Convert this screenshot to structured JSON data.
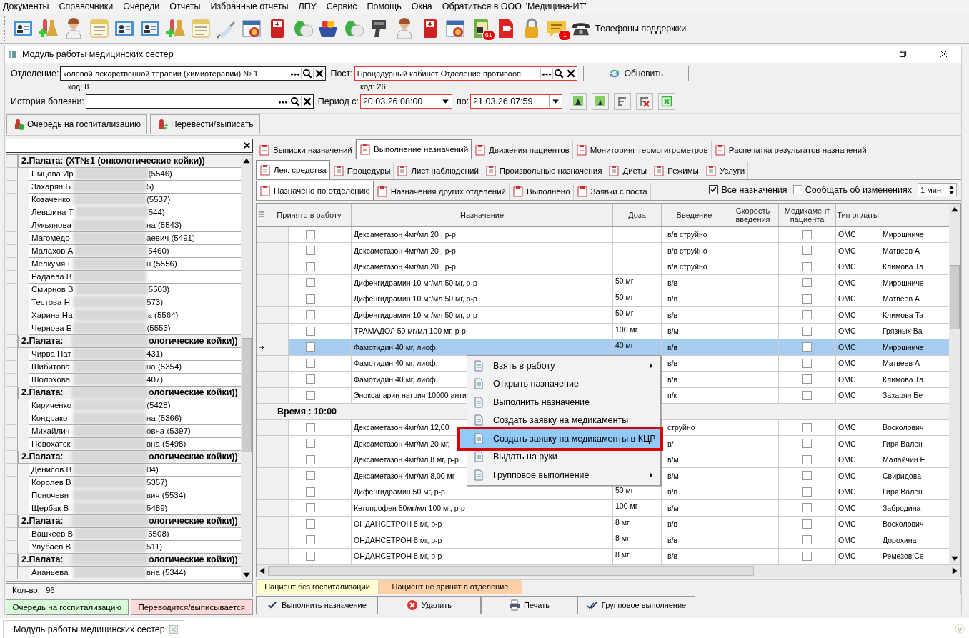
{
  "menu_bar": [
    "Документы",
    "Справочники",
    "Очереди",
    "Отчеты",
    "Избранные отчеты",
    "ЛПУ",
    "Сервис",
    "Помощь",
    "Окна",
    "Обратиться в ООО \"Медицина-ИТ\""
  ],
  "toolbar": {
    "badges": [
      "61",
      "1"
    ],
    "support": "Телефоны поддержки"
  },
  "window": {
    "title": "Модуль работы медицинских сестер"
  },
  "filters": {
    "department_label": "Отделение:",
    "department": "колевой лекарственной терапии (химиотерапии) № 1",
    "department_code": "код: 8",
    "post_label": "Пост:",
    "post": "Процедурный кабинет Отделение противооп",
    "post_code": "код: 26",
    "refresh": "Обновить",
    "history_label": "История болезни:",
    "period_from_label": "Период с:",
    "period_from": "20.03.26 08:00",
    "period_to_label": "по:",
    "period_to": "21.03.26 07:59"
  },
  "actions": [
    "Очередь на госпитализацию",
    "Перевести/выписать"
  ],
  "patients": {
    "groups": [
      {
        "prefix": "2.Палата:  (ХТ№1 (онкологические койки))",
        "children": [
          {
            "prefix": "Емцова Ир",
            "suffix": "(5546)"
          },
          {
            "prefix": "Захарян Б",
            "suffix": "5)"
          },
          {
            "prefix": "Козаченко",
            "suffix": "(5537)"
          },
          {
            "prefix": "Левшина Т",
            "suffix": "544)"
          },
          {
            "prefix": "Лукьянова",
            "suffix": "на (5543)"
          },
          {
            "prefix": "Магомедо",
            "suffix": "аевич (5491)"
          },
          {
            "prefix": "Малахов А",
            "suffix": "5460)"
          },
          {
            "prefix": "Мелкумян",
            "suffix": "н (5556)"
          },
          {
            "prefix": "Радаева В"
          },
          {
            "prefix": "Смирнов В",
            "suffix": "5503)"
          },
          {
            "prefix": "Тестова Н",
            "suffix": "573)"
          },
          {
            "prefix": "Харина На",
            "suffix": "а (5564)"
          },
          {
            "prefix": "Чернова Е",
            "suffix": "(5553)"
          }
        ]
      },
      {
        "prefix": "2.Палата:",
        "suffix": "ологические койки))",
        "children": [
          {
            "prefix": "Чирва Нат",
            "suffix": "431)"
          },
          {
            "prefix": "Шибитова",
            "suffix": "на (5354)"
          },
          {
            "prefix": "Шолохова",
            "suffix": "407)"
          }
        ]
      },
      {
        "prefix": "2.Палата:",
        "suffix": "ологические койки))",
        "children": [
          {
            "prefix": "Кириченко",
            "suffix": "(5428)"
          },
          {
            "prefix": "Кондрако",
            "suffix": "на (5366)"
          },
          {
            "prefix": "Михайлич",
            "suffix": "овна (5397)"
          },
          {
            "prefix": "Новохатск",
            "suffix": "вна (5498)"
          }
        ]
      },
      {
        "prefix": "2.Палата:",
        "suffix": "ологические койки))",
        "children": [
          {
            "prefix": "Денисов В",
            "suffix": "04)"
          },
          {
            "prefix": "Королев В",
            "suffix": "5357)"
          },
          {
            "prefix": "Поночевн",
            "suffix": "вич (5534)"
          },
          {
            "prefix": "Щербак В",
            "suffix": "5489)"
          }
        ]
      },
      {
        "prefix": "2.Палата:",
        "suffix": "ологические койки))",
        "children": [
          {
            "prefix": "Вашкеев В",
            "suffix": "5508)"
          },
          {
            "prefix": "Улубаев В",
            "suffix": "511)"
          }
        ]
      },
      {
        "prefix": "2.Палата:",
        "suffix": "ологические койки))",
        "children": [
          {
            "prefix": "Ананьева",
            "suffix": "вна (5344)"
          }
        ]
      }
    ],
    "count_label": "Кол-во:",
    "count": "96",
    "legend": [
      {
        "label": "Очередь на госпитализацию",
        "color": "#d8fbd8"
      },
      {
        "label": "Переводится/выписывается",
        "color": "#ffd8d8"
      }
    ]
  },
  "tabs": [
    {
      "label": "Выписки назначений",
      "selected": false
    },
    {
      "label": "Выполнение назначений",
      "selected": true
    },
    {
      "label": "Движения пациентов",
      "selected": false
    },
    {
      "label": "Мониторинг термогигрометров",
      "selected": false
    },
    {
      "label": "Распечатка результатов назначений",
      "selected": false
    }
  ],
  "subtabs": [
    {
      "label": "Лек. средства",
      "selected": true
    },
    {
      "label": "Процедуры",
      "selected": false
    },
    {
      "label": "Лист наблюдений",
      "selected": false
    },
    {
      "label": "Произвольные назначения",
      "selected": false
    },
    {
      "label": "Диеты",
      "selected": false
    },
    {
      "label": "Режимы",
      "selected": false
    },
    {
      "label": "Услуги",
      "selected": false
    }
  ],
  "view_tabs": [
    {
      "label": "Назначено по отделению",
      "selected": true
    },
    {
      "label": "Назначения других отделений",
      "selected": false
    },
    {
      "label": "Выполнено",
      "selected": false
    },
    {
      "label": "Заявки с поста",
      "selected": false
    }
  ],
  "options": {
    "all": {
      "label": "Все назначения",
      "checked": true
    },
    "notify": {
      "label": "Сообщать об изменениях",
      "checked": false
    },
    "interval": "1 мин"
  },
  "table": {
    "columns": [
      "Принято в работу",
      "Назначение",
      "Доза",
      "Введение",
      "Скорость введения",
      "Медикамент пациента",
      "Тип оплаты"
    ],
    "rows": [
      {
        "kind": "item",
        "accepted": false,
        "name": "Дексаметазон 4мг/мл 20 , р-р",
        "dose": "",
        "route": "в/в струйно",
        "own": false,
        "pay": "ОМС",
        "column_9": "Мирошниче",
        "selected": false
      },
      {
        "kind": "item",
        "accepted": false,
        "name": "Дексаметазон 4мг/мл 20 , р-р",
        "dose": "",
        "route": "в/в струйно",
        "own": false,
        "pay": "ОМС",
        "column_9": "Матвеев А",
        "selected": false
      },
      {
        "kind": "item",
        "accepted": false,
        "name": "Дексаметазон 4мг/мл 20 , р-р",
        "dose": "",
        "route": "в/в струйно",
        "own": false,
        "pay": "ОМС",
        "column_9": "Климова Та",
        "selected": false
      },
      {
        "kind": "item",
        "accepted": false,
        "name": "Дифенгидрамин 10 мг/мл 50 мг, р-р",
        "dose": "50 мг",
        "route": "в/в",
        "own": false,
        "pay": "ОМС",
        "column_9": "Мирошниче",
        "selected": false
      },
      {
        "kind": "item",
        "accepted": false,
        "name": "Дифенгидрамин 10 мг/мл 50 мг, р-р",
        "dose": "50 мг",
        "route": "в/в",
        "own": false,
        "pay": "ОМС",
        "column_9": "Матвеев А",
        "selected": false
      },
      {
        "kind": "item",
        "accepted": false,
        "name": "Дифенгидрамин 10 мг/мл 50 мг, р-р",
        "dose": "50 мг",
        "route": "в/в",
        "own": false,
        "pay": "ОМС",
        "column_9": "Климова Та",
        "selected": false
      },
      {
        "kind": "item",
        "accepted": false,
        "name": "ТРАМАДОЛ 50 мг/мл 100 мг, р-р",
        "dose": "100 мг",
        "route": "в/м",
        "own": false,
        "pay": "ОМС",
        "column_9": "Грязных Ва",
        "selected": false
      },
      {
        "kind": "item",
        "accepted": false,
        "name": "Фамотидин 40 мг, лиоф.",
        "dose": "40 мг",
        "route": "в/в",
        "own": false,
        "pay": "ОМС",
        "column_9": "Мирошниче",
        "selected": true
      },
      {
        "kind": "item",
        "accepted": false,
        "name": "Фамотидин 40 мг, лиоф.",
        "dose": "",
        "route": "в/в",
        "own": false,
        "pay": "ОМС",
        "column_9": "Матвеев А",
        "selected": false
      },
      {
        "kind": "item",
        "accepted": false,
        "name": "Фамотидин 40 мг, лиоф.",
        "dose": "",
        "route": "в/в",
        "own": false,
        "pay": "ОМС",
        "column_9": "Климова Та",
        "selected": false
      },
      {
        "kind": "item",
        "accepted": false,
        "name": "Эноксапарин натрия 10000 анти",
        "dose": "",
        "route": "п/к",
        "own": false,
        "pay": "ОМС",
        "column_9": "Захарян Бе",
        "selected": false
      },
      {
        "kind": "time",
        "label": "Время : 10:00"
      },
      {
        "kind": "item",
        "accepted": false,
        "name": "Дексаметазон 4мг/мл 12,00",
        "dose": "",
        "route": "струйно",
        "own": false,
        "pay": "ОМС",
        "column_9": "Восколович",
        "selected": false
      },
      {
        "kind": "item",
        "accepted": false,
        "name": "Дексаметазон 4мг/мл 20 мг,",
        "dose": "",
        "route": "в/",
        "own": false,
        "pay": "ОМС",
        "column_9": "Гиря Вален",
        "selected": false
      },
      {
        "kind": "item",
        "accepted": false,
        "name": "Дексаметазон 4мг/мл 8 мг, р-р",
        "dose": "",
        "route": "в/м",
        "own": false,
        "pay": "ОМС",
        "column_9": "Малайчин Е",
        "selected": false
      },
      {
        "kind": "item",
        "accepted": false,
        "name": "Дексаметазон 4мг/мл 8,00 мг",
        "dose": "",
        "route": "в/м",
        "own": false,
        "pay": "ОМС",
        "column_9": "Свиридова",
        "selected": false
      },
      {
        "kind": "item",
        "accepted": false,
        "name": "Дифенгидрамин 50 мг, р-р",
        "dose": "50 мг",
        "route": "в/в",
        "own": false,
        "pay": "ОМС",
        "column_9": "Гиря Вален",
        "selected": false
      },
      {
        "kind": "item",
        "accepted": false,
        "name": "Кетопрофен 50мг/мл  100 мг, р-р",
        "dose": "100 мг",
        "route": "в/м",
        "own": false,
        "pay": "ОМС",
        "column_9": "Забродина",
        "selected": false
      },
      {
        "kind": "item",
        "accepted": false,
        "name": "ОНДАНСЕТРОН 8 мг, р-р",
        "dose": "8 мг",
        "route": "в/в",
        "own": false,
        "pay": "ОМС",
        "column_9": "Восколович",
        "selected": false
      },
      {
        "kind": "item",
        "accepted": false,
        "name": "ОНДАНСЕТРОН 8 мг, р-р",
        "dose": "8 мг",
        "route": "в/в",
        "own": false,
        "pay": "ОМС",
        "column_9": "Дорохина",
        "selected": false
      },
      {
        "kind": "item",
        "accepted": false,
        "name": "ОНДАНСЕТРОН 8 мг, р-р",
        "dose": "8 мг",
        "route": "в/в",
        "own": false,
        "pay": "ОМС",
        "column_9": "Ремезов Се",
        "selected": false
      }
    ]
  },
  "context_menu": [
    {
      "label": "Взять в работу",
      "has_submenu": true,
      "selected": false
    },
    {
      "label": "Открыть назначение",
      "has_submenu": false,
      "selected": false
    },
    {
      "label": "Выполнить назначение",
      "has_submenu": false,
      "selected": false
    },
    {
      "label": "Создать заявку на медикаменты",
      "has_submenu": false,
      "selected": false
    },
    {
      "label": "Создать заявку на медикаменты в КЦР",
      "has_submenu": false,
      "selected": true
    },
    {
      "label": "Выдать на руки",
      "has_submenu": false,
      "selected": false
    },
    {
      "label": "Групповое выполнение",
      "has_submenu": true,
      "selected": false
    }
  ],
  "status_legend": [
    {
      "label": "Пациент без госпитализации",
      "color": "#ffffd0"
    },
    {
      "label": "Пациент не принят в отделение",
      "color": "#fdd0a8"
    }
  ],
  "bottom_buttons": [
    "Выполнить назначение",
    "Удалить",
    "Печать",
    "Групповое выполнение"
  ],
  "taskbar": {
    "tab": "Модуль работы медицинских сестер"
  }
}
